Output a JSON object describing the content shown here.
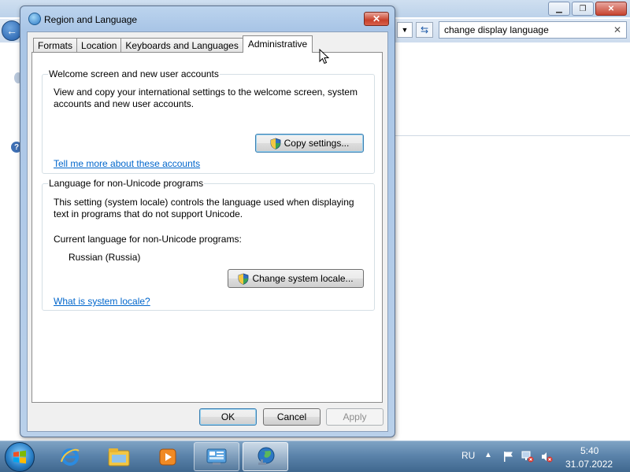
{
  "background_window": {
    "search_value": "change display language"
  },
  "dialog": {
    "title": "Region and Language",
    "tabs": [
      {
        "label": "Formats"
      },
      {
        "label": "Location"
      },
      {
        "label": "Keyboards and Languages"
      },
      {
        "label": "Administrative",
        "active": true
      }
    ],
    "welcome_group": {
      "title": "Welcome screen and new user accounts",
      "description_line1": "View and copy your international settings to the welcome screen, system",
      "description_line2": "accounts and new user accounts.",
      "copy_button": "Copy settings...",
      "link": "Tell me more about these accounts"
    },
    "unicode_group": {
      "title": "Language for non-Unicode programs",
      "description_line1": "This setting (system locale) controls the language used when displaying",
      "description_line2": "text in programs that do not support Unicode.",
      "current_label": "Current language for non-Unicode programs:",
      "current_value": "Russian (Russia)",
      "change_button": "Change system locale...",
      "link": "What is system locale?"
    },
    "buttons": {
      "ok": "OK",
      "cancel": "Cancel",
      "apply": "Apply"
    }
  },
  "taskbar": {
    "language": "RU",
    "time": "5:40",
    "date": "31.07.2022",
    "items": [
      {
        "icon": "internet-explorer-icon"
      },
      {
        "icon": "windows-explorer-icon"
      },
      {
        "icon": "media-player-icon"
      },
      {
        "icon": "control-panel-icon",
        "state": "running"
      },
      {
        "icon": "region-language-icon",
        "state": "active"
      }
    ]
  },
  "colors": {
    "link": "#0066cc",
    "close_button": "#c8402a",
    "taskbar": "#5c84ab"
  }
}
